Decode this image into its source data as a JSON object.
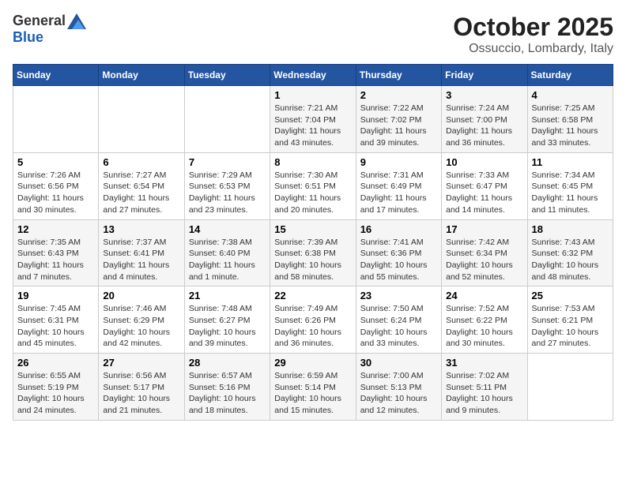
{
  "logo": {
    "general": "General",
    "blue": "Blue"
  },
  "title": "October 2025",
  "location": "Ossuccio, Lombardy, Italy",
  "headers": [
    "Sunday",
    "Monday",
    "Tuesday",
    "Wednesday",
    "Thursday",
    "Friday",
    "Saturday"
  ],
  "weeks": [
    [
      {
        "day": "",
        "info": ""
      },
      {
        "day": "",
        "info": ""
      },
      {
        "day": "",
        "info": ""
      },
      {
        "day": "1",
        "info": "Sunrise: 7:21 AM\nSunset: 7:04 PM\nDaylight: 11 hours and 43 minutes."
      },
      {
        "day": "2",
        "info": "Sunrise: 7:22 AM\nSunset: 7:02 PM\nDaylight: 11 hours and 39 minutes."
      },
      {
        "day": "3",
        "info": "Sunrise: 7:24 AM\nSunset: 7:00 PM\nDaylight: 11 hours and 36 minutes."
      },
      {
        "day": "4",
        "info": "Sunrise: 7:25 AM\nSunset: 6:58 PM\nDaylight: 11 hours and 33 minutes."
      }
    ],
    [
      {
        "day": "5",
        "info": "Sunrise: 7:26 AM\nSunset: 6:56 PM\nDaylight: 11 hours and 30 minutes."
      },
      {
        "day": "6",
        "info": "Sunrise: 7:27 AM\nSunset: 6:54 PM\nDaylight: 11 hours and 27 minutes."
      },
      {
        "day": "7",
        "info": "Sunrise: 7:29 AM\nSunset: 6:53 PM\nDaylight: 11 hours and 23 minutes."
      },
      {
        "day": "8",
        "info": "Sunrise: 7:30 AM\nSunset: 6:51 PM\nDaylight: 11 hours and 20 minutes."
      },
      {
        "day": "9",
        "info": "Sunrise: 7:31 AM\nSunset: 6:49 PM\nDaylight: 11 hours and 17 minutes."
      },
      {
        "day": "10",
        "info": "Sunrise: 7:33 AM\nSunset: 6:47 PM\nDaylight: 11 hours and 14 minutes."
      },
      {
        "day": "11",
        "info": "Sunrise: 7:34 AM\nSunset: 6:45 PM\nDaylight: 11 hours and 11 minutes."
      }
    ],
    [
      {
        "day": "12",
        "info": "Sunrise: 7:35 AM\nSunset: 6:43 PM\nDaylight: 11 hours and 7 minutes."
      },
      {
        "day": "13",
        "info": "Sunrise: 7:37 AM\nSunset: 6:41 PM\nDaylight: 11 hours and 4 minutes."
      },
      {
        "day": "14",
        "info": "Sunrise: 7:38 AM\nSunset: 6:40 PM\nDaylight: 11 hours and 1 minute."
      },
      {
        "day": "15",
        "info": "Sunrise: 7:39 AM\nSunset: 6:38 PM\nDaylight: 10 hours and 58 minutes."
      },
      {
        "day": "16",
        "info": "Sunrise: 7:41 AM\nSunset: 6:36 PM\nDaylight: 10 hours and 55 minutes."
      },
      {
        "day": "17",
        "info": "Sunrise: 7:42 AM\nSunset: 6:34 PM\nDaylight: 10 hours and 52 minutes."
      },
      {
        "day": "18",
        "info": "Sunrise: 7:43 AM\nSunset: 6:32 PM\nDaylight: 10 hours and 48 minutes."
      }
    ],
    [
      {
        "day": "19",
        "info": "Sunrise: 7:45 AM\nSunset: 6:31 PM\nDaylight: 10 hours and 45 minutes."
      },
      {
        "day": "20",
        "info": "Sunrise: 7:46 AM\nSunset: 6:29 PM\nDaylight: 10 hours and 42 minutes."
      },
      {
        "day": "21",
        "info": "Sunrise: 7:48 AM\nSunset: 6:27 PM\nDaylight: 10 hours and 39 minutes."
      },
      {
        "day": "22",
        "info": "Sunrise: 7:49 AM\nSunset: 6:26 PM\nDaylight: 10 hours and 36 minutes."
      },
      {
        "day": "23",
        "info": "Sunrise: 7:50 AM\nSunset: 6:24 PM\nDaylight: 10 hours and 33 minutes."
      },
      {
        "day": "24",
        "info": "Sunrise: 7:52 AM\nSunset: 6:22 PM\nDaylight: 10 hours and 30 minutes."
      },
      {
        "day": "25",
        "info": "Sunrise: 7:53 AM\nSunset: 6:21 PM\nDaylight: 10 hours and 27 minutes."
      }
    ],
    [
      {
        "day": "26",
        "info": "Sunrise: 6:55 AM\nSunset: 5:19 PM\nDaylight: 10 hours and 24 minutes."
      },
      {
        "day": "27",
        "info": "Sunrise: 6:56 AM\nSunset: 5:17 PM\nDaylight: 10 hours and 21 minutes."
      },
      {
        "day": "28",
        "info": "Sunrise: 6:57 AM\nSunset: 5:16 PM\nDaylight: 10 hours and 18 minutes."
      },
      {
        "day": "29",
        "info": "Sunrise: 6:59 AM\nSunset: 5:14 PM\nDaylight: 10 hours and 15 minutes."
      },
      {
        "day": "30",
        "info": "Sunrise: 7:00 AM\nSunset: 5:13 PM\nDaylight: 10 hours and 12 minutes."
      },
      {
        "day": "31",
        "info": "Sunrise: 7:02 AM\nSunset: 5:11 PM\nDaylight: 10 hours and 9 minutes."
      },
      {
        "day": "",
        "info": ""
      }
    ]
  ]
}
